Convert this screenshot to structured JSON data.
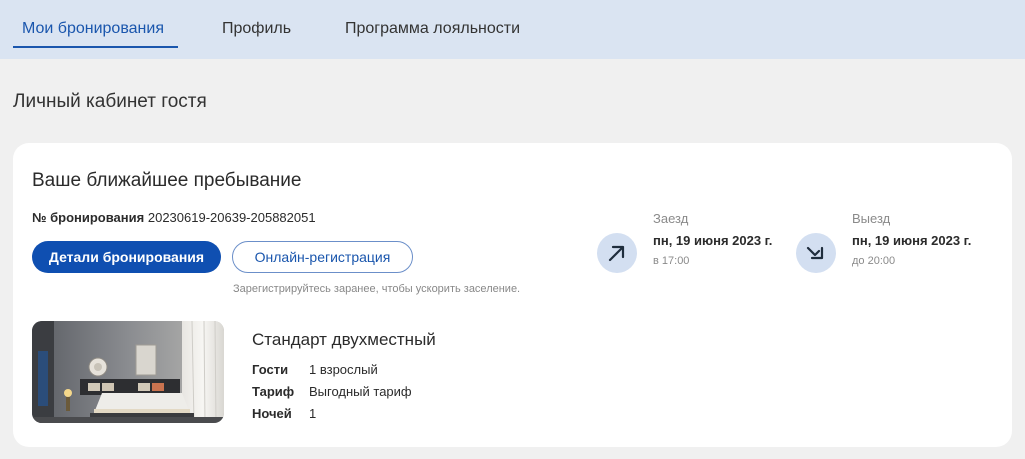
{
  "tabs": [
    {
      "label": "Мои бронирования"
    },
    {
      "label": "Профиль"
    },
    {
      "label": "Программа лояльности"
    }
  ],
  "page": {
    "title": "Личный кабинет гостя"
  },
  "stay": {
    "title": "Ваше ближайшее пребывание",
    "booking_label": "№ бронирования",
    "booking_number": "20230619-20639-205882051",
    "details_button": "Детали бронирования",
    "checkin_button": "Онлайн-регистрация",
    "hint": "Зарегистрируйтесь заранее, чтобы ускорить заселение.",
    "arrival": {
      "label": "Заезд",
      "date": "пн, 19 июня 2023 г.",
      "time": "в 17:00",
      "icon": "arrow-up-right-icon"
    },
    "departure": {
      "label": "Выезд",
      "date": "пн, 19 июня 2023 г.",
      "time": "до 20:00",
      "icon": "arrow-down-right-icon"
    }
  },
  "room": {
    "name": "Стандарт двухместный",
    "details": [
      {
        "label": "Гости",
        "value": "1 взрослый"
      },
      {
        "label": "Тариф",
        "value": "Выгодный тариф"
      },
      {
        "label": "Ночей",
        "value": "1"
      }
    ]
  },
  "colors": {
    "accent": "#0f4fb1",
    "tab_bar": "#dae4f2",
    "icon_bg": "#d3dff1"
  }
}
